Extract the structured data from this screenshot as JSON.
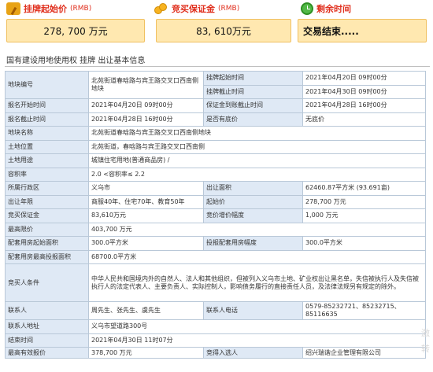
{
  "summary": {
    "start_price": {
      "title": "挂牌起始价",
      "unit": "(RMB)",
      "value": "278, 700 万元",
      "icon": "hammer-icon"
    },
    "deposit": {
      "title": "竞买保证金",
      "unit": "(RMB)",
      "value": "83, 610万元",
      "icon": "coins-icon"
    },
    "remaining": {
      "title": "剩余时间",
      "value": "交易结束.....",
      "icon": "clock-icon"
    }
  },
  "section_title": "国有建设用地使用权 挂牌 出让基本信息",
  "details": {
    "r1": {
      "l1": "地块编号",
      "v1": "北苑街道春晗路与宾王路交叉口西南侧地块",
      "l2a": "挂牌起始时间",
      "v2a": "2021年04月20日 09时00分",
      "l2b": "挂牌截止时间",
      "v2b": "2021年04月30日 09时00分"
    },
    "r2": {
      "l1": "报名开始时间",
      "v1": "2021年04月20日 09时00分",
      "l2": "保证金到账截止时间",
      "v2": "2021年04月28日 16时00分"
    },
    "r3": {
      "l1": "报名截止时间",
      "v1": "2021年04月28日 16时00分",
      "l2": "是否有底价",
      "v2": "无底价"
    },
    "r4": {
      "l1": "地块名称",
      "v1": "北苑街道春晗路与宾王路交叉口西南侧地块"
    },
    "r5": {
      "l1": "土地位置",
      "v1": "北苑街道，春晗路与宾王路交叉口西南侧"
    },
    "r6": {
      "l1": "土地用途",
      "v1": "城镇住宅用地(普通商品房) /"
    },
    "r7": {
      "l1": "容积率",
      "v1": "2.0 <容积率≤ 2.2"
    },
    "r8": {
      "l1": "所属行政区",
      "v1": "义乌市",
      "l2": "出让面积",
      "v2": "62460.87平方米 (93.691亩)"
    },
    "r9": {
      "l1": "出让年限",
      "v1": "商服40年、住宅70年、教育50年",
      "l2": "起始价",
      "v2": "278,700 万元"
    },
    "r10": {
      "l1": "竞买保证金",
      "v1": "83,610万元",
      "l2": "竞价增价幅度",
      "v2": "1,000 万元"
    },
    "r11": {
      "l1": "最高限价",
      "v1": "403,700 万元"
    },
    "r12": {
      "l1": "配套用房起始面积",
      "v1": "300.0平方米",
      "l2": "投报配套用房幅度",
      "v2": "300.0平方米"
    },
    "r13": {
      "l1": "配套用房最高投报面积",
      "v1": "68700.0平方米"
    },
    "r14": {
      "l1": "竞买人条件",
      "v1": "中华人民共和国境内外的自然人、法人和其他组织，但被列入义乌市土地、矿业权出让黑名单，失信被执行人及失信被执行人的法定代表人、主要负责人、实际控制人，影响债务履行的直接责任人员，及法律法规另有规定的除外。"
    },
    "r15": {
      "l1": "联系人",
      "v1": "周先生、张先生、虞先生",
      "l2": "联系人电话",
      "v2": "0579-85232721、85232715、85116635"
    },
    "r16": {
      "l1": "联系人地址",
      "v1": "义乌市望道路300号"
    },
    "r17": {
      "l1": "结束时间",
      "v1": "2021年04月30日 11时07分"
    },
    "r18": {
      "l1": "最高有效报价",
      "v1": "378,700 万元",
      "l2": "竞得入选人",
      "v2": "绍兴瑞谐企业管理有限公司"
    }
  },
  "watermark": {
    "line1": "激",
    "line2": "转"
  }
}
